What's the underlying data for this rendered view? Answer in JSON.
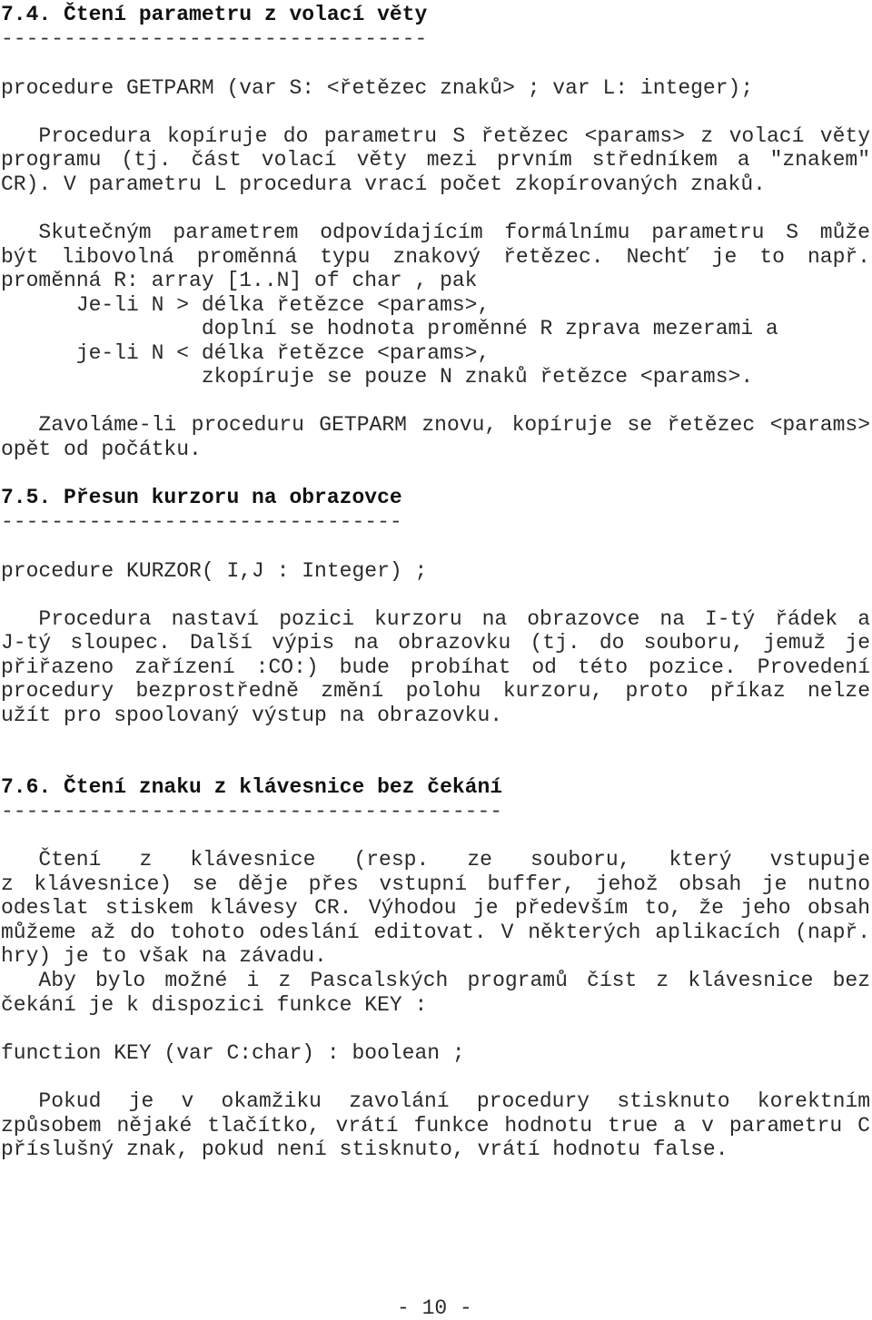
{
  "sections": [
    {
      "heading": "7.4. Čtení parametru z volací věty",
      "rule": "----------------------------------",
      "signature": "procedure GETPARM (var S: <řetězec znaků> ; var L: integer);",
      "para1": [
        "   Procedura kopíruje do parametru S řetězec <params> z volací věty",
        "programu (tj. část volací věty mezi prvním středníkem a \"znakem\"",
        "CR). V parametru L procedura vrací počet zkopírovaných znaků."
      ],
      "para2": [
        "   Skutečným parametrem odpovídajícím formálnímu parametru S může",
        "být libovolná proměnná typu znakový řetězec. Nechť je to např.",
        "proměnná R: array [1..N] of char , pak",
        "      Je-li N > délka řetězce <params>,",
        "                doplní se hodnota proměnné R zprava mezerami a",
        "      je-li N < délka řetězce <params>,",
        "                zkopíruje se pouze N znaků řetězce <params>."
      ],
      "para3": [
        "   Zavoláme-li proceduru GETPARM znovu, kopíruje se řetězec <params>",
        "opět od počátku."
      ]
    },
    {
      "heading": "7.5. Přesun kurzoru na obrazovce",
      "rule": "--------------------------------",
      "signature": "procedure KURZOR( I,J : Integer) ;",
      "para1": [
        "   Procedura nastaví pozici kurzoru na obrazovce na I-tý řádek a",
        "J-tý sloupec. Další výpis na obrazovku (tj. do souboru, jemuž je",
        "přiřazeno zařízení :CO:) bude probíhat od této pozice. Provedení",
        "procedury bezprostředně změní polohu kurzoru, proto příkaz nelze",
        "užít pro spoolovaný výstup na obrazovku."
      ]
    },
    {
      "heading": "7.6. Čtení znaku z klávesnice bez čekání",
      "rule": "----------------------------------------",
      "para1": [
        "   Čtení z klávesnice (resp. ze souboru, který vstupuje",
        "z klávesnice) se děje přes vstupní buffer, jehož obsah je nutno",
        "odeslat stiskem klávesy CR. Výhodou je především to, že jeho obsah",
        "můžeme až do tohoto odeslání editovat. V některých aplikacích (např.",
        "hry) je to však na závadu.",
        "   Aby bylo možné i z Pascalských programů číst z klávesnice bez",
        "čekání je k dispozici funkce KEY :"
      ],
      "signature": "function KEY (var C:char) : boolean ;",
      "para2": [
        "   Pokud je v okamžiku zavolání procedury stisknuto korektním",
        "způsobem nějaké tlačítko, vrátí funkce hodnotu true a v parametru C",
        "příslušný znak, pokud není stisknuto, vrátí hodnotu false."
      ]
    }
  ],
  "footer": {
    "page_number": "- 10 -"
  }
}
